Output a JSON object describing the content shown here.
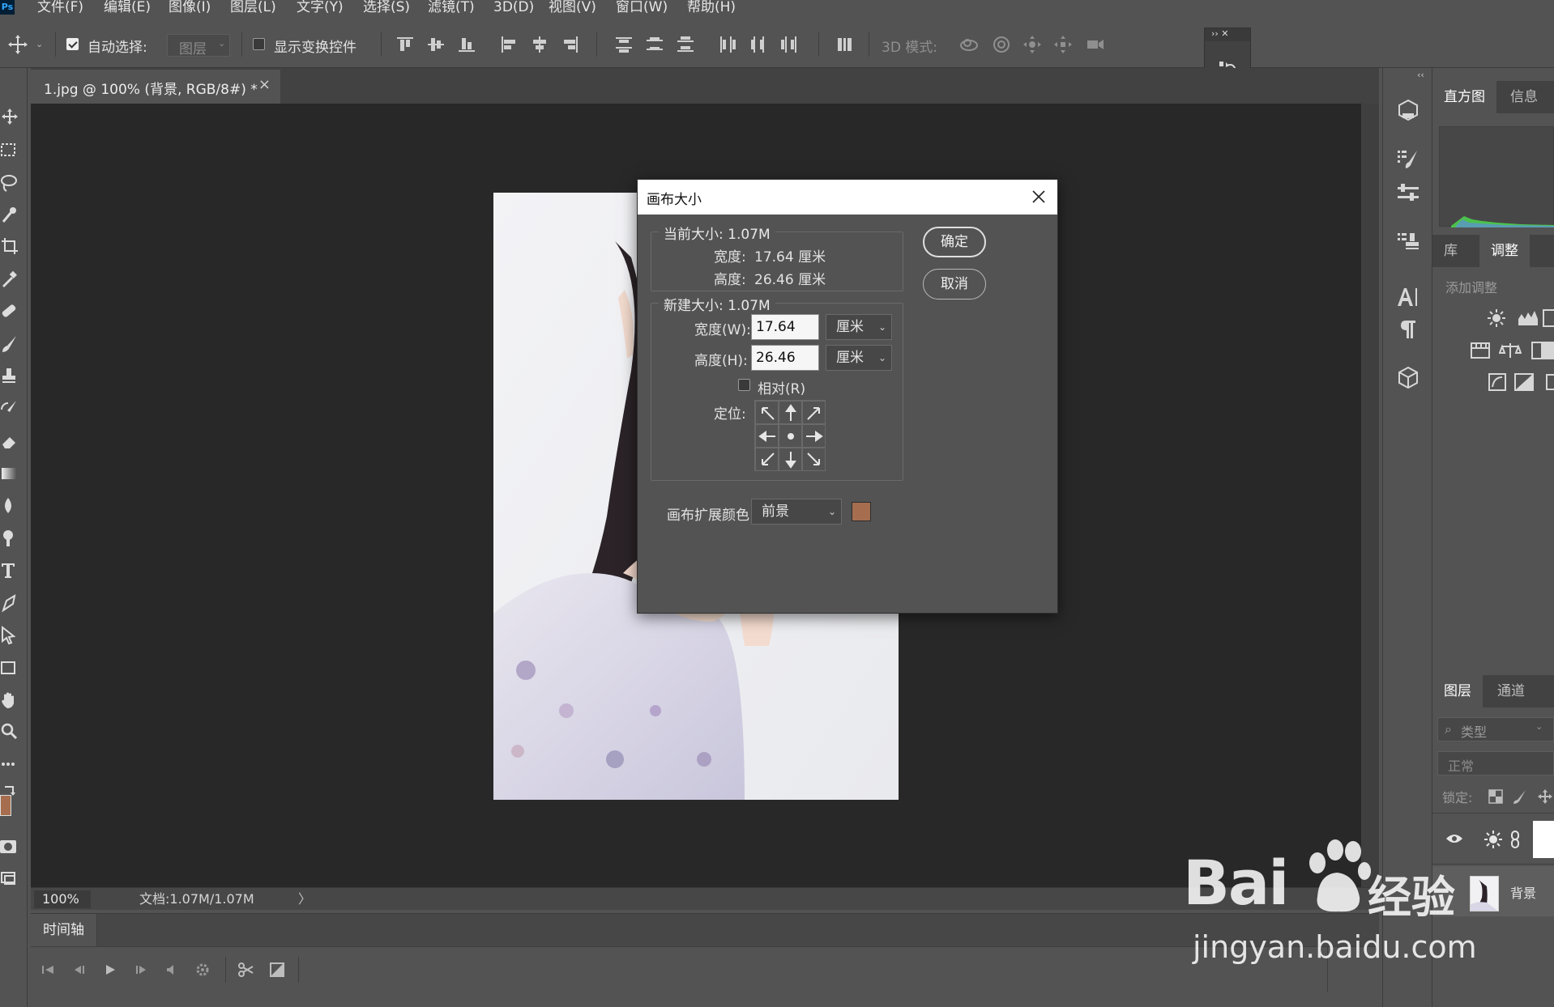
{
  "app": {
    "logo": "Ps",
    "menu": [
      "文件(F)",
      "编辑(E)",
      "图像(I)",
      "图层(L)",
      "文字(Y)",
      "选择(S)",
      "滤镜(T)",
      "3D(D)",
      "视图(V)",
      "窗口(W)",
      "帮助(H)"
    ]
  },
  "options": {
    "auto_select_label": "自动选择:",
    "auto_select_checked": true,
    "auto_select_target": "图层",
    "show_transform_label": "显示变换控件",
    "show_transform_checked": false,
    "mode_3d_label": "3D 模式:"
  },
  "document": {
    "tab_title": "1.jpg @ 100% (背景, RGB/8#) *",
    "close_glyph": "×"
  },
  "status": {
    "zoom": "100%",
    "doc_info": "文档:1.07M/1.07M",
    "arrow": "〉"
  },
  "timeline": {
    "tab": "时间轴"
  },
  "mini_panel": {
    "head": "›› ✕"
  },
  "panels": {
    "collapse_glyph": "‹‹",
    "top_tabs": [
      "直方图",
      "信息"
    ],
    "mid_tabs": [
      "库",
      "调整"
    ],
    "add_adjustment": "添加调整",
    "layers_tabs": [
      "图层",
      "通道"
    ],
    "filter_kind": "类型",
    "blend_mode": "正常",
    "lock_label": "锁定:",
    "layer_name": "背景"
  },
  "dialog": {
    "title": "画布大小",
    "current_size_label": "当前大小: 1.07M",
    "current_width_label": "宽度:",
    "current_width_value": "17.64 厘米",
    "current_height_label": "高度:",
    "current_height_value": "26.46 厘米",
    "new_size_label": "新建大小: 1.07M",
    "width_label": "宽度(W):",
    "width_value": "17.64",
    "height_label": "高度(H):",
    "height_value": "26.46",
    "unit": "厘米",
    "relative_label": "相对(R)",
    "relative_checked": false,
    "anchor_label": "定位:",
    "ext_color_label": "画布扩展颜色:",
    "ext_color_value": "前景",
    "ext_color_swatch": "#a66e4f",
    "ok_label": "确定",
    "cancel_label": "取消"
  },
  "colors": {
    "foreground": "#a66e4f",
    "background": "#ffffff",
    "ui_panel": "#535353",
    "canvas_bg": "#282828"
  },
  "watermark": {
    "brand": "Bai",
    "brand_suffix": "经验",
    "url": "jingyan.baidu.com"
  }
}
